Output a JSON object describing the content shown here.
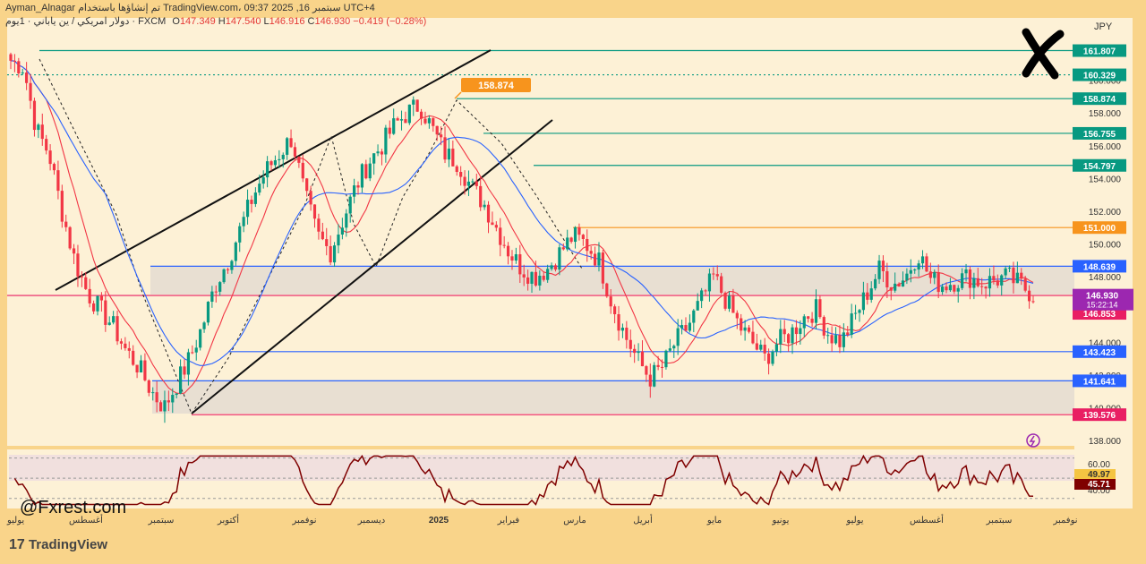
{
  "header": {
    "author_line": "Ayman_Alnagar تم إنشاؤها باستخدام TradingView.com، 09:37 2025 ,16 سبتمبر UTC+4",
    "symbol_line": "دولار امريكي / ين ياباني · 1يوم · FXCM",
    "ohlc": {
      "o_label": "O",
      "o": "147.349",
      "h_label": "H",
      "h": "147.540",
      "l_label": "L",
      "l": "146.916",
      "c_label": "C",
      "c": "146.930",
      "chg": "−0.419 (−0.28%)"
    }
  },
  "currency_label": "JPY",
  "watermark": "TradingView",
  "handle": "@Fxrest.com",
  "chart_data": {
    "type": "candlestick",
    "symbol": "USDJPY",
    "timeframe": "1D",
    "price_axis": {
      "min": 138.0,
      "max": 162.0,
      "ticks": [
        "138.000",
        "140.000",
        "142.000",
        "144.000",
        "146.000",
        "148.000",
        "150.000",
        "152.000",
        "154.000",
        "156.000",
        "158.000",
        "160.000",
        "162.000"
      ]
    },
    "time_axis": [
      "أغسطس",
      "سبتمبر",
      "أكتوبر",
      "نوفمبر",
      "ديسمبر",
      "2025",
      "فبراير",
      "مارس",
      "أبريل",
      "مايو",
      "يونيو",
      "يوليو",
      "أغسطس",
      "سبتمبر",
      "نوفمبر"
    ],
    "time_axis_left_stub": "يوليو",
    "close_path": [
      161.2,
      160.8,
      157.0,
      155.5,
      152.0,
      149.0,
      147.0,
      146.0,
      145.0,
      143.5,
      142.5,
      141.0,
      140.0,
      141.5,
      143.0,
      145.0,
      147.5,
      149.0,
      151.0,
      153.0,
      154.5,
      155.5,
      156.5,
      153.0,
      150.5,
      149.5,
      151.5,
      153.5,
      155.0,
      156.0,
      157.2,
      158.0,
      158.5,
      157.0,
      155.5,
      155.0,
      153.5,
      152.5,
      151.0,
      149.5,
      148.5,
      148.0,
      148.5,
      149.5,
      150.5,
      150.0,
      149.0,
      146.5,
      144.5,
      143.0,
      141.8,
      142.5,
      144.0,
      145.0,
      146.5,
      148.0,
      146.5,
      145.0,
      144.0,
      143.0,
      144.0,
      144.5,
      145.5,
      146.0,
      144.5,
      144.0,
      145.5,
      147.0,
      148.5,
      147.5,
      148.0,
      149.5,
      147.8,
      147.5,
      147.8,
      148.0,
      147.6,
      147.8,
      148.0,
      147.5,
      146.9
    ],
    "levels": [
      {
        "value": "161.807",
        "color": "#089981",
        "dotted": false
      },
      {
        "value": "160.329",
        "color": "#089981",
        "dotted": true
      },
      {
        "value": "158.874",
        "color": "#089981",
        "dotted": false
      },
      {
        "value": "156.755",
        "color": "#089981",
        "dotted": false
      },
      {
        "value": "154.797",
        "color": "#089981",
        "dotted": false
      },
      {
        "value": "151.000",
        "color": "#f7941d",
        "dotted": false
      },
      {
        "value": "148.639",
        "color": "#2962ff",
        "dotted": false
      },
      {
        "value": "146.853",
        "color": "#e91e63",
        "dotted": false
      },
      {
        "value": "143.423",
        "color": "#2962ff",
        "dotted": false
      },
      {
        "value": "141.641",
        "color": "#2962ff",
        "dotted": false
      },
      {
        "value": "139.576",
        "color": "#e91e63",
        "dotted": false
      }
    ],
    "last_price": {
      "value": "146.930",
      "countdown": "15:22:14"
    },
    "peak_callout": "158.874",
    "rsi": {
      "values": [
        "60.00",
        "49.97",
        "45.71",
        "40.00"
      ],
      "levels": [
        70,
        50,
        30
      ]
    }
  }
}
